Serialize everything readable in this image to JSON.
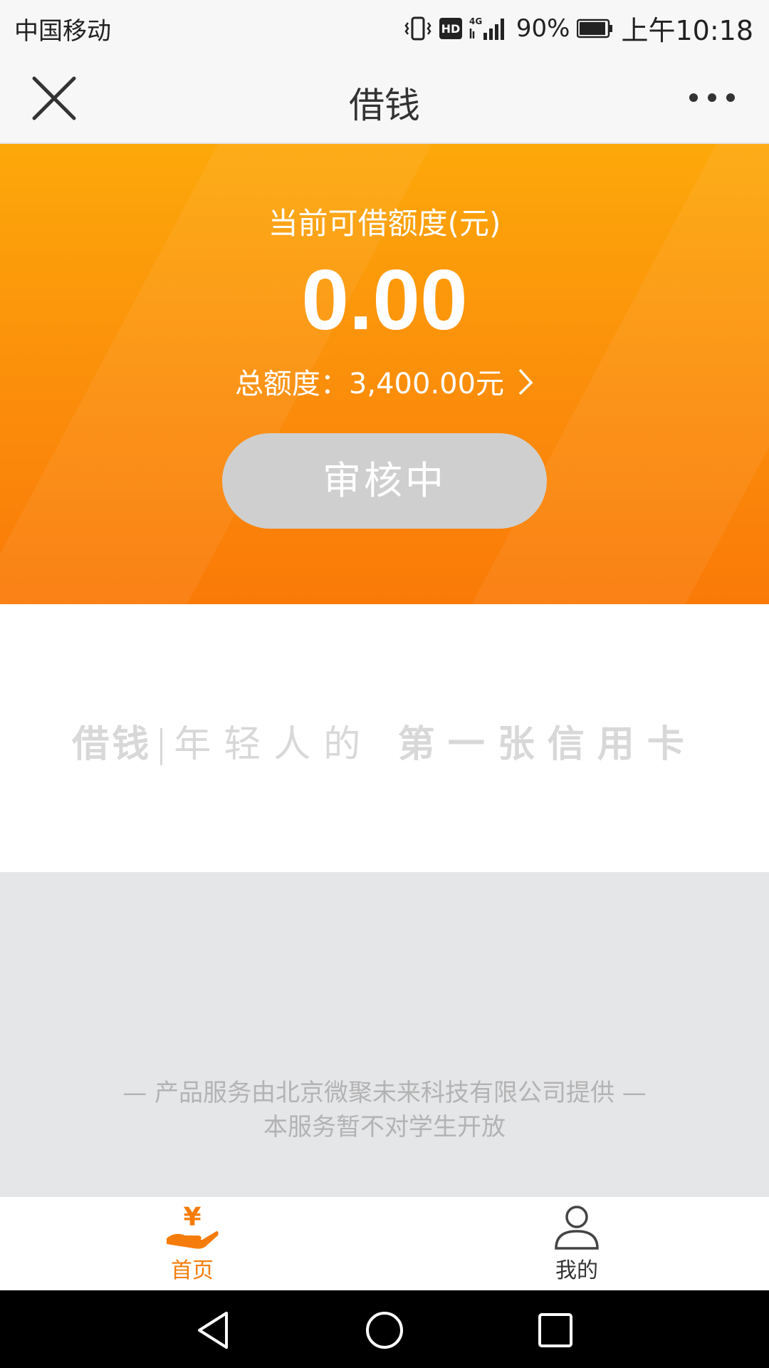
{
  "status_bar": {
    "carrier": "中国移动",
    "network": "4G",
    "battery": "90%",
    "time": "上午10:18"
  },
  "title_bar": {
    "title": "借钱",
    "close_icon": "close-icon",
    "more_icon": "more-dots-icon"
  },
  "hero": {
    "label": "当前可借额度(元)",
    "amount": "0.00",
    "total_label": "总额度：3,400.00元",
    "status_button": "审核中"
  },
  "slogan": {
    "brand": "借钱",
    "part1": "年轻人的",
    "part2": "第一张信用卡"
  },
  "footer": {
    "line1": "— 产品服务由北京微聚未来科技有限公司提供 —",
    "line2": "本服务暂不对学生开放"
  },
  "tabs": [
    {
      "label": "首页",
      "icon": "yuan-hand-icon",
      "active": true
    },
    {
      "label": "我的",
      "icon": "person-icon",
      "active": false
    }
  ],
  "colors": {
    "accent": "#f57c0a",
    "hero_top": "#fda80a",
    "hero_bottom": "#fa7a08",
    "pill": "#cfcfcf"
  }
}
